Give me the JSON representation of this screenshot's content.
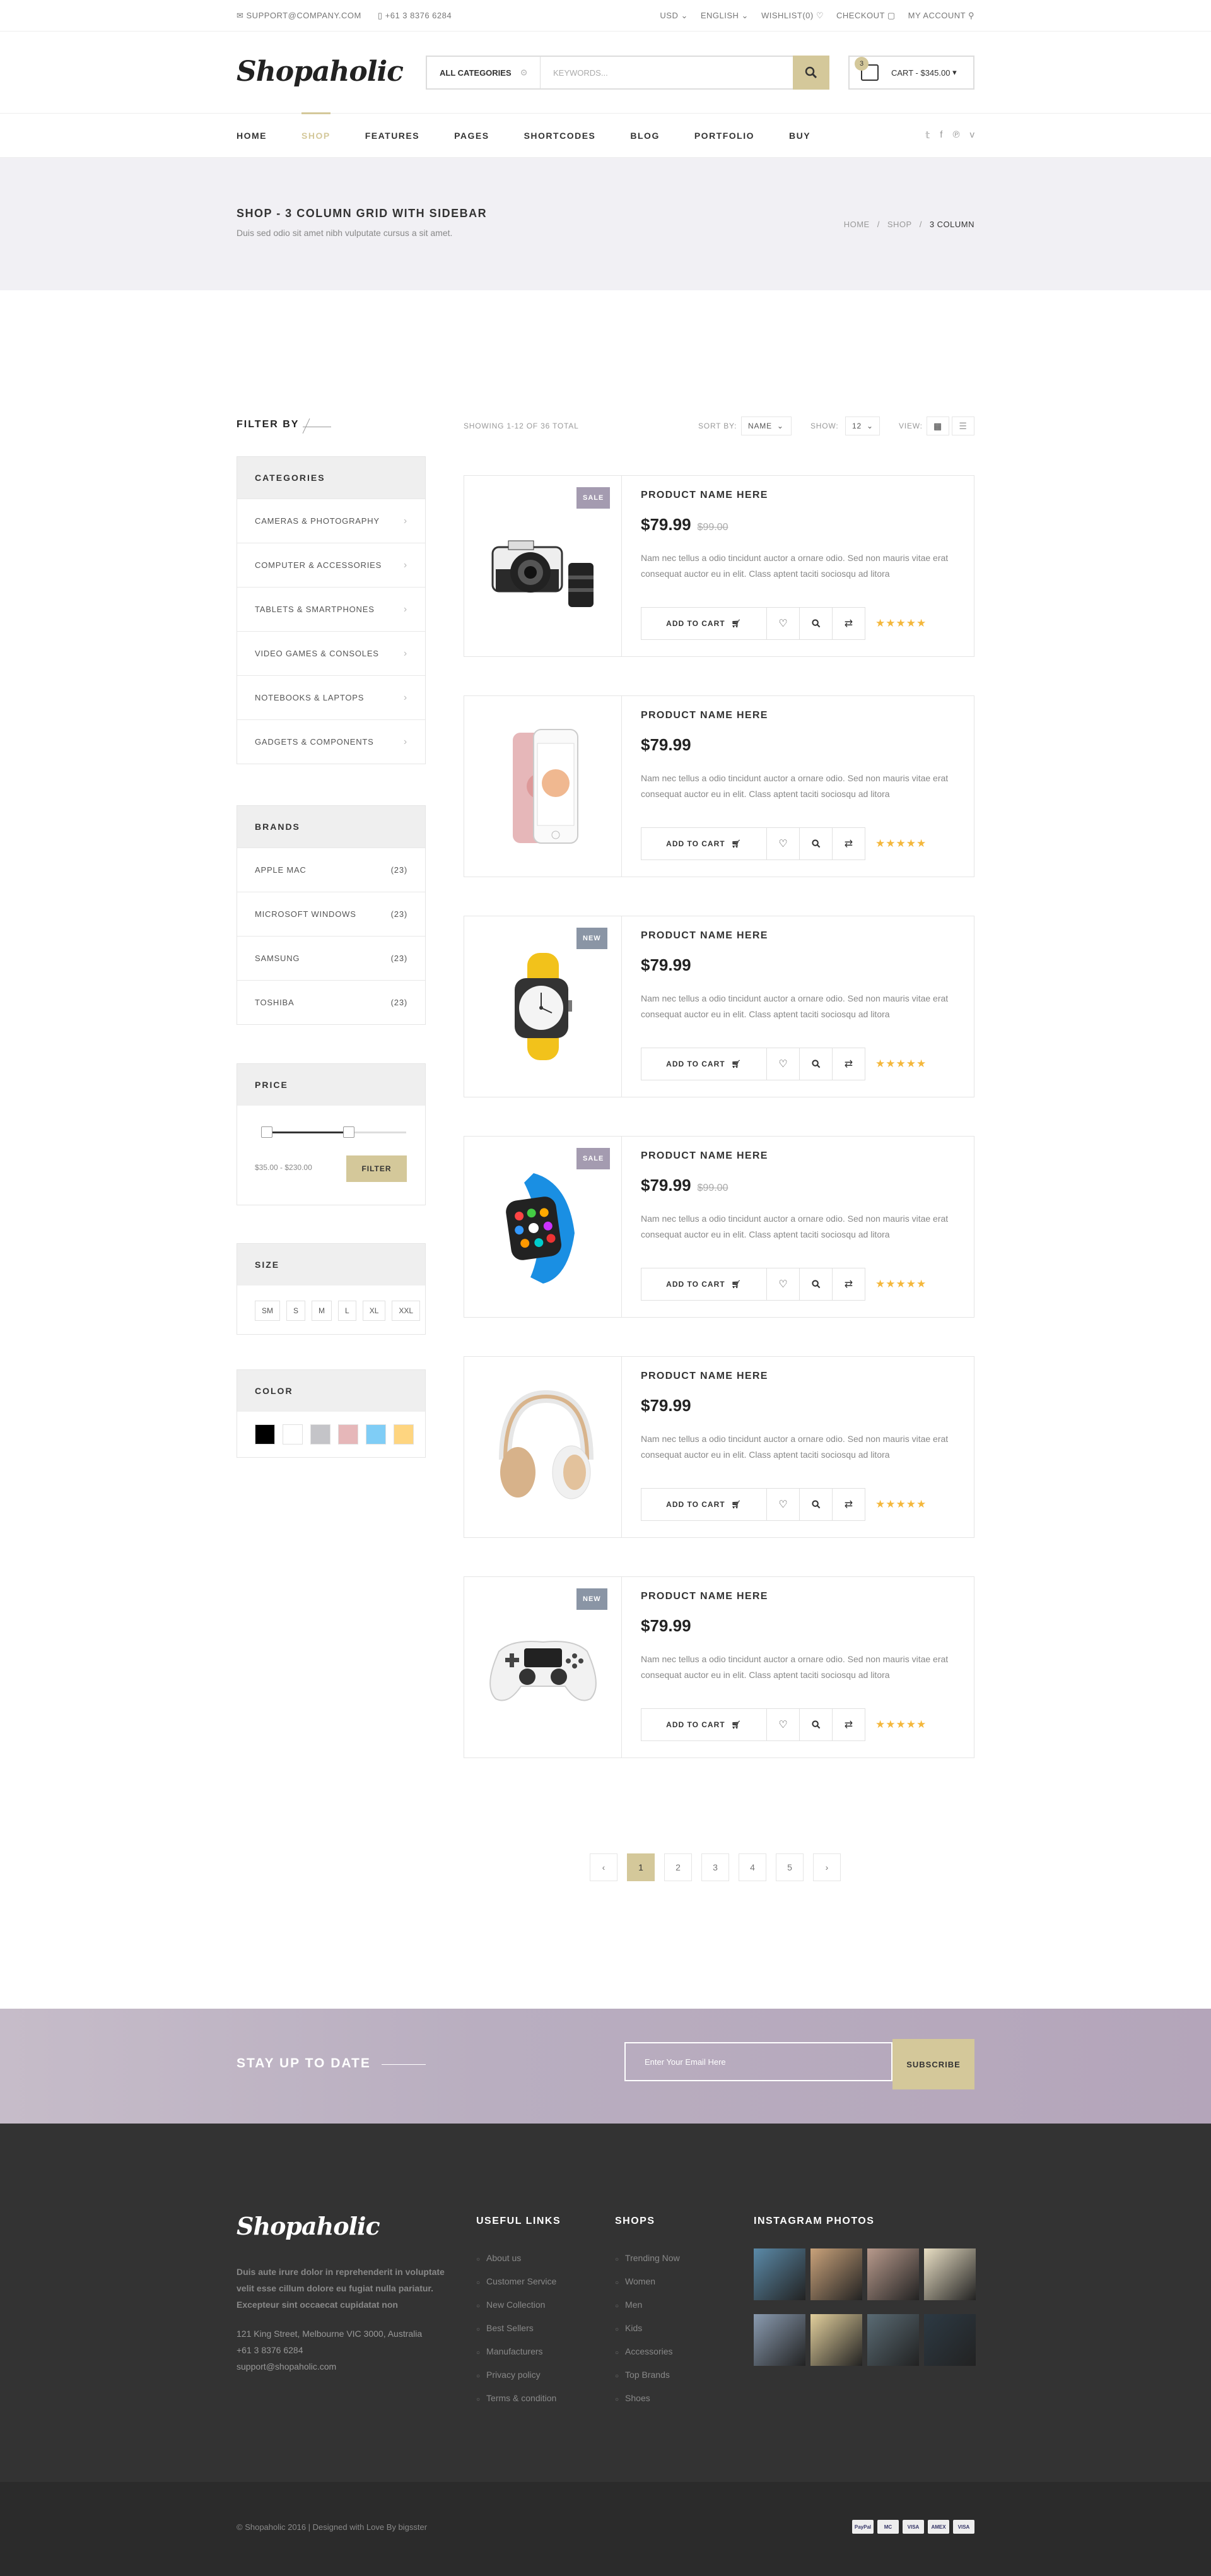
{
  "topbar": {
    "email": "SUPPORT@COMPANY.COM",
    "phone": "+61 3 8376 6284",
    "currency": "USD",
    "language": "ENGLISH",
    "wishlist": "WISHLIST(0)",
    "checkout": "CHECKOUT",
    "account": "MY ACCOUNT"
  },
  "header": {
    "logo": "Shopaholic",
    "search": {
      "category": "ALL CATEGORIES",
      "placeholder": "KEYWORDS..."
    },
    "cart": {
      "count": "3",
      "label": "CART - $345.00"
    }
  },
  "nav": {
    "items": [
      "HOME",
      "SHOP",
      "FEATURES",
      "PAGES",
      "SHORTCODES",
      "BLOG",
      "PORTFOLIO",
      "BUY"
    ],
    "active": "SHOP",
    "social": [
      "twitter-icon",
      "facebook-icon",
      "pinterest-icon",
      "vimeo-icon"
    ]
  },
  "band": {
    "title": "SHOP - 3 COLUMN GRID WITH SIDEBAR",
    "subtitle": "Duis sed odio sit amet nibh vulputate cursus a sit amet.",
    "breadcrumb": [
      "HOME",
      "SHOP",
      "3 COLUMN"
    ]
  },
  "sidebar": {
    "filter_by": "FILTER BY",
    "categories": {
      "title": "CATEGORIES",
      "items": [
        "CAMERAS & PHOTOGRAPHY",
        "COMPUTER & ACCESSORIES",
        "TABLETS & SMARTPHONES",
        "VIDEO GAMES & CONSOLES",
        "NOTEBOOKS & LAPTOPS",
        "GADGETS & COMPONENTS"
      ]
    },
    "brands": {
      "title": "BRANDS",
      "items": [
        {
          "name": "APPLE MAC",
          "count": "(23)"
        },
        {
          "name": "MICROSOFT WINDOWS",
          "count": "(23)"
        },
        {
          "name": "SAMSUNG",
          "count": "(23)"
        },
        {
          "name": "TOSHIBA",
          "count": "(23)"
        }
      ]
    },
    "price": {
      "title": "PRICE",
      "range": "$35.00 - $230.00",
      "button": "FILTER"
    },
    "size": {
      "title": "SIZE",
      "items": [
        "SM",
        "S",
        "M",
        "L",
        "XL",
        "XXL"
      ]
    },
    "color": {
      "title": "COLOR",
      "swatches": [
        "#000000",
        "#ffffff",
        "#c4c4c8",
        "#e6b7b9",
        "#7fcdf6",
        "#fed580"
      ]
    }
  },
  "toolbar": {
    "showing": "SHOWING 1-12 OF 36 TOTAL",
    "sort_label": "SORT BY:",
    "sort_value": "NAME",
    "show_label": "SHOW:",
    "show_value": "12",
    "view_label": "VIEW:"
  },
  "products": [
    {
      "name": "PRODUCT NAME HERE",
      "price": "$79.99",
      "old_price": "$99.00",
      "badge": "SALE",
      "badge_color": "#a49bb0",
      "image": "camera"
    },
    {
      "name": "PRODUCT NAME HERE",
      "price": "$79.99",
      "old_price": "",
      "badge": "",
      "badge_color": "",
      "image": "iphone"
    },
    {
      "name": "PRODUCT NAME HERE",
      "price": "$79.99",
      "old_price": "",
      "badge": "NEW",
      "badge_color": "#8a95a5",
      "image": "watch-yellow"
    },
    {
      "name": "PRODUCT NAME HERE",
      "price": "$79.99",
      "old_price": "$99.00",
      "badge": "SALE",
      "badge_color": "#a49bb0",
      "image": "watch-blue"
    },
    {
      "name": "PRODUCT NAME HERE",
      "price": "$79.99",
      "old_price": "",
      "badge": "",
      "badge_color": "",
      "image": "headphones"
    },
    {
      "name": "PRODUCT NAME HERE",
      "price": "$79.99",
      "old_price": "",
      "badge": "NEW",
      "badge_color": "#8a95a5",
      "image": "gamepad"
    }
  ],
  "product_common": {
    "description": "Nam nec tellus a odio tincidunt auctor a ornare odio. Sed non  mauris vitae erat consequat auctor eu in elit. Class aptent taciti sociosqu ad litora",
    "add_to_cart": "ADD TO CART",
    "stars": "★★★★★"
  },
  "pagination": {
    "prev": "‹",
    "pages": [
      "1",
      "2",
      "3",
      "4",
      "5"
    ],
    "current": "1",
    "next": "›"
  },
  "newsletter": {
    "title": "STAY UP TO DATE",
    "placeholder": "Enter Your Email Here",
    "button": "SUBSCRIBE"
  },
  "footer": {
    "logo": "Shopaholic",
    "about": "Duis aute irure dolor in reprehenderit in voluptate velit esse cillum dolore eu fugiat nulla pariatur. Excepteur sint occaecat cupidatat non",
    "address": "121 King Street, Melbourne VIC 3000, Australia",
    "phone": "+61 3 8376 6284",
    "email": "support@shopaholic.com",
    "useful_links": {
      "title": "USEFUL LINKS",
      "items": [
        "About us",
        "Customer Service",
        "New Collection",
        "Best Sellers",
        "Manufacturers",
        "Privacy policy",
        "Terms & condition"
      ]
    },
    "shops": {
      "title": "SHOPS",
      "items": [
        "Trending Now",
        "Women",
        "Men",
        "Kids",
        "Accessories",
        "Top Brands",
        "Shoes"
      ]
    },
    "instagram": {
      "title": "INSTAGRAM PHOTOS",
      "tiles": [
        "#5b8aa8",
        "#c9a27a",
        "#b89a8c",
        "#e9dfc4",
        "#8a9bb0",
        "#e2cf9c",
        "#5a6b74",
        "#2d3a44"
      ]
    },
    "copyright": "© Shopaholic 2016 | Designed with Love By bigsster",
    "payments": [
      "PayPal",
      "MC",
      "VISA",
      "AMEX",
      "VISA"
    ]
  }
}
